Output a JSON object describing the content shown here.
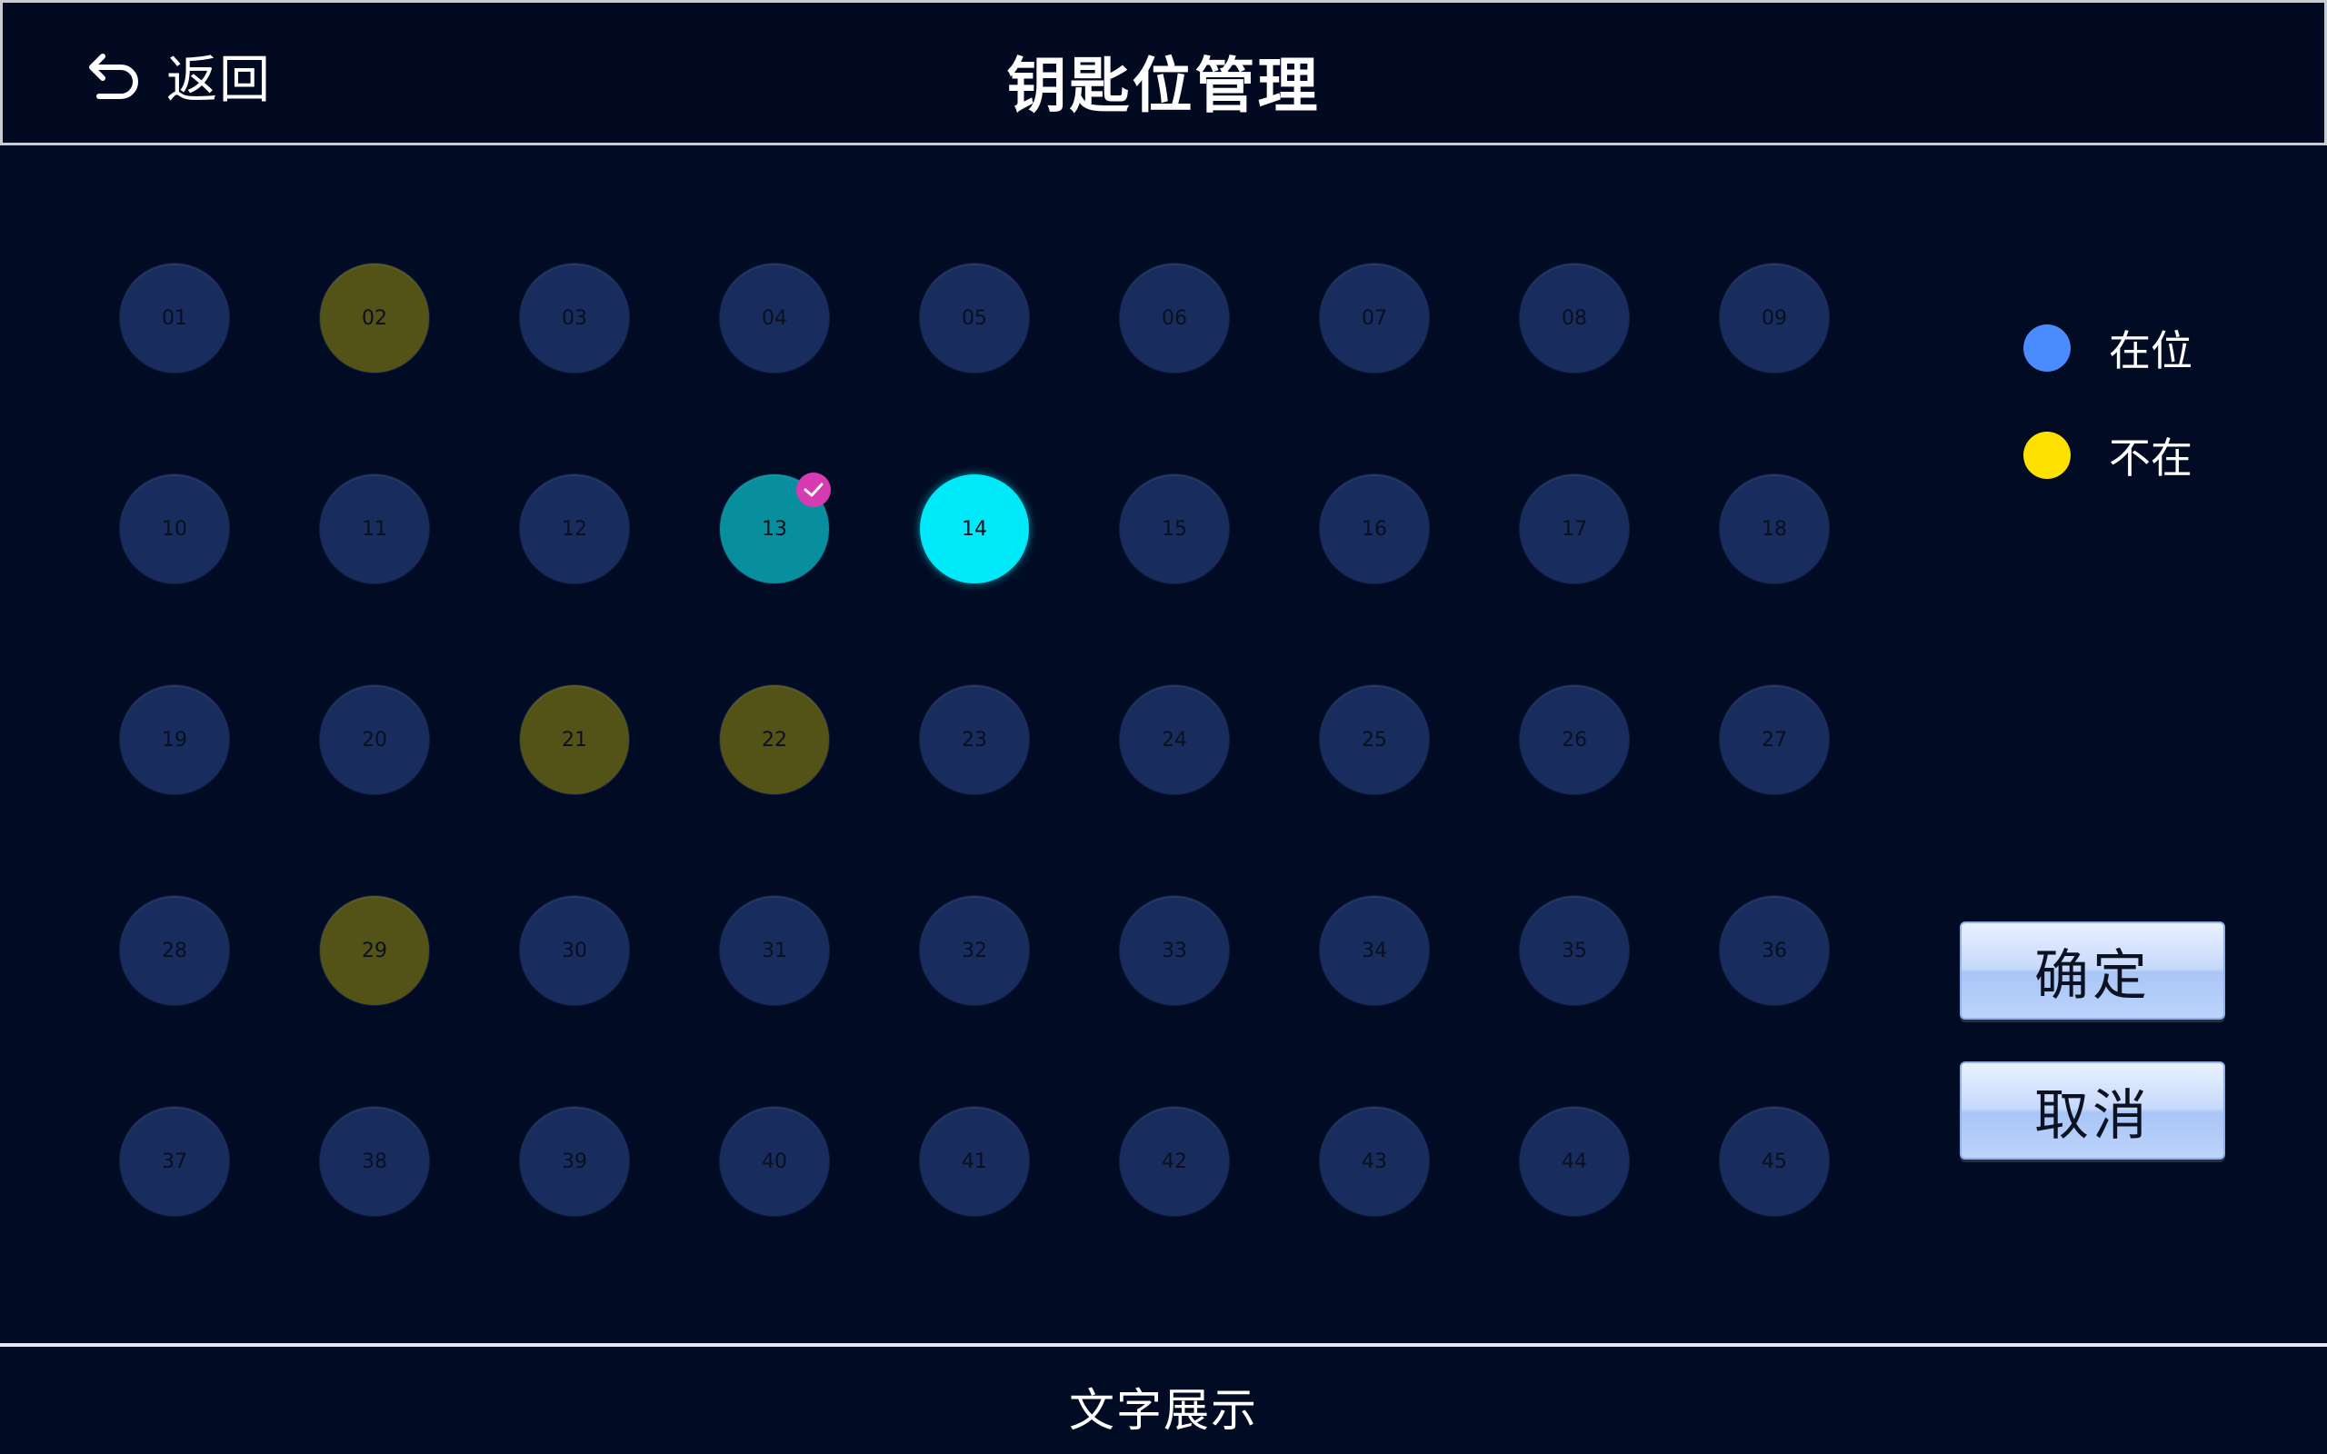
{
  "header": {
    "back_label": "返回",
    "title": "钥匙位管理"
  },
  "slots": [
    {
      "label": "01",
      "status": "present"
    },
    {
      "label": "02",
      "status": "absent"
    },
    {
      "label": "03",
      "status": "present"
    },
    {
      "label": "04",
      "status": "present"
    },
    {
      "label": "05",
      "status": "present"
    },
    {
      "label": "06",
      "status": "present"
    },
    {
      "label": "07",
      "status": "present"
    },
    {
      "label": "08",
      "status": "present"
    },
    {
      "label": "09",
      "status": "present"
    },
    {
      "label": "10",
      "status": "present"
    },
    {
      "label": "11",
      "status": "present"
    },
    {
      "label": "12",
      "status": "present"
    },
    {
      "label": "13",
      "status": "selected-present",
      "checked": true
    },
    {
      "label": "14",
      "status": "highlight"
    },
    {
      "label": "15",
      "status": "present"
    },
    {
      "label": "16",
      "status": "present"
    },
    {
      "label": "17",
      "status": "present"
    },
    {
      "label": "18",
      "status": "present"
    },
    {
      "label": "19",
      "status": "present"
    },
    {
      "label": "20",
      "status": "present"
    },
    {
      "label": "21",
      "status": "absent"
    },
    {
      "label": "22",
      "status": "absent"
    },
    {
      "label": "23",
      "status": "present"
    },
    {
      "label": "24",
      "status": "present"
    },
    {
      "label": "25",
      "status": "present"
    },
    {
      "label": "26",
      "status": "present"
    },
    {
      "label": "27",
      "status": "present"
    },
    {
      "label": "28",
      "status": "present"
    },
    {
      "label": "29",
      "status": "absent"
    },
    {
      "label": "30",
      "status": "present"
    },
    {
      "label": "31",
      "status": "present"
    },
    {
      "label": "32",
      "status": "present"
    },
    {
      "label": "33",
      "status": "present"
    },
    {
      "label": "34",
      "status": "present"
    },
    {
      "label": "35",
      "status": "present"
    },
    {
      "label": "36",
      "status": "present"
    },
    {
      "label": "37",
      "status": "present"
    },
    {
      "label": "38",
      "status": "present"
    },
    {
      "label": "39",
      "status": "present"
    },
    {
      "label": "40",
      "status": "present"
    },
    {
      "label": "41",
      "status": "present"
    },
    {
      "label": "42",
      "status": "present"
    },
    {
      "label": "43",
      "status": "present"
    },
    {
      "label": "44",
      "status": "present"
    },
    {
      "label": "45",
      "status": "present"
    }
  ],
  "legend": [
    {
      "label": "在位",
      "color": "#4a8cff"
    },
    {
      "label": "不在",
      "color": "#ffe100"
    }
  ],
  "actions": {
    "confirm_label": "确定",
    "cancel_label": "取消"
  },
  "footer": {
    "text": "文字展示"
  },
  "colors": {
    "background": "#010b24",
    "slot_present": "#182d5e",
    "slot_absent": "#535317",
    "slot_selected": "#078f9e",
    "slot_highlight": "#00e9f9",
    "check_badge": "#d63bb4"
  }
}
